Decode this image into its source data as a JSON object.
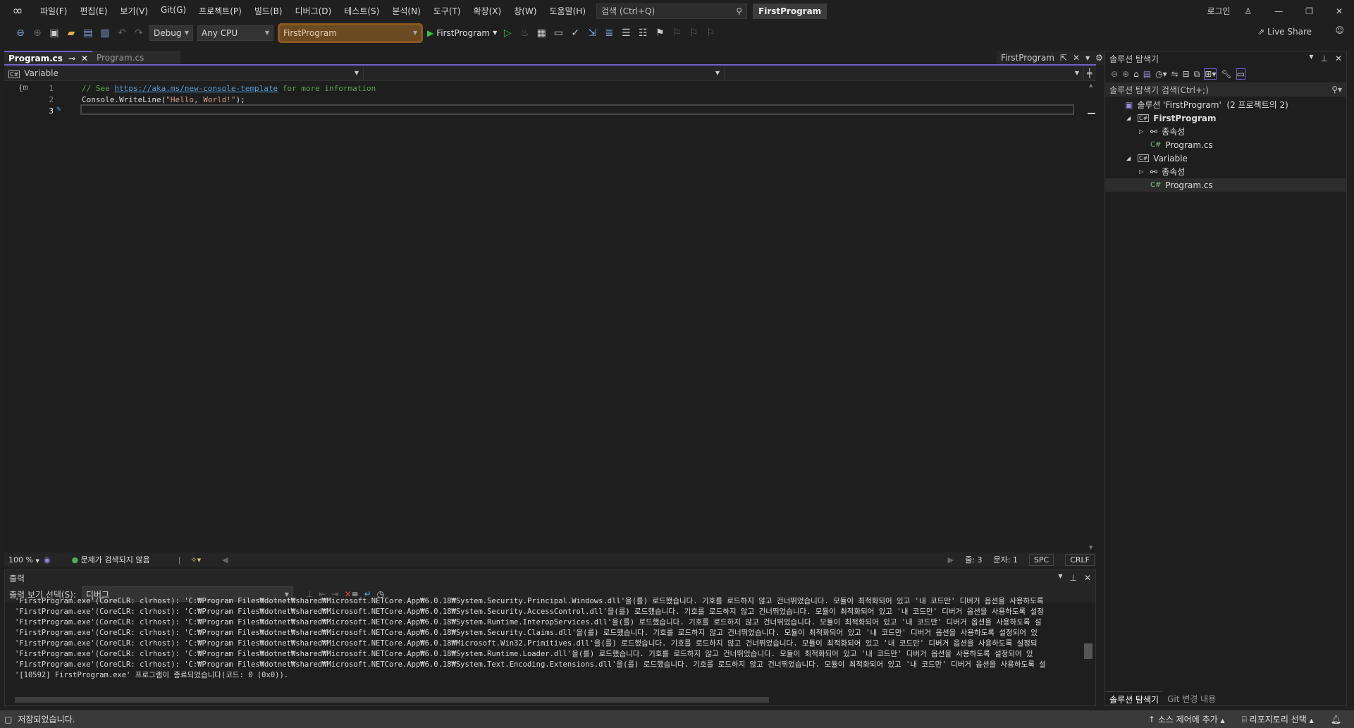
{
  "menubar": {
    "items": [
      "파일(F)",
      "편집(E)",
      "보기(V)",
      "Git(G)",
      "프로젝트(P)",
      "빌드(B)",
      "디버그(D)",
      "테스트(S)",
      "분석(N)",
      "도구(T)",
      "확장(X)",
      "창(W)",
      "도움말(H)"
    ],
    "search_placeholder": "검색 (Ctrl+Q)",
    "project_name": "FirstProgram",
    "login": "로그인"
  },
  "toolbar": {
    "config": "Debug",
    "platform": "Any CPU",
    "startup_project": "FirstProgram",
    "run_label": "FirstProgram",
    "live_share": "Live Share"
  },
  "tabs": [
    {
      "label": "Program.cs",
      "active": true
    },
    {
      "label": "Program.cs",
      "active": false
    }
  ],
  "preview_tab": "FirstProgram",
  "navbar": {
    "project": "Variable"
  },
  "editor": {
    "lines": [
      {
        "num": "1",
        "parts": [
          {
            "t": "// See ",
            "c": "cmt"
          },
          {
            "t": "https://aka.ms/new-console-template",
            "c": "lnk"
          },
          {
            "t": " for more information",
            "c": "cmt"
          }
        ]
      },
      {
        "num": "2",
        "parts": [
          {
            "t": "Console.WriteLine(",
            "c": "id"
          },
          {
            "t": "\"Hello, World!\"",
            "c": "str"
          },
          {
            "t": ");",
            "c": "id"
          }
        ]
      },
      {
        "num": "3",
        "parts": []
      }
    ]
  },
  "editor_status": {
    "zoom": "100 %",
    "issues": "문제가 검색되지 않음",
    "line": "줄: 3",
    "char": "문자: 1",
    "spaces": "SPC",
    "eol": "CRLF"
  },
  "output": {
    "title": "출력",
    "source_label": "출력 보기 선택(S):",
    "source_value": "디버그",
    "lines": [
      "'FirstProgram.exe'(CoreCLR: clrhost): 'C:₩Program Files₩dotnet₩shared₩Microsoft.NETCore.App₩6.0.18₩System.Security.Principal.Windows.dll'을(를) 로드했습니다. 기호를 로드하지 않고 건너뛰었습니다. 모듈이 최적화되어 있고 '내 코드만' 디버거 옵션을 사용하도록",
      "'FirstProgram.exe'(CoreCLR: clrhost): 'C:₩Program Files₩dotnet₩shared₩Microsoft.NETCore.App₩6.0.18₩System.Security.AccessControl.dll'을(를) 로드했습니다. 기호를 로드하지 않고 건너뛰었습니다. 모듈이 최적화되어 있고 '내 코드만' 디버거 옵션을 사용하도록 설정",
      "'FirstProgram.exe'(CoreCLR: clrhost): 'C:₩Program Files₩dotnet₩shared₩Microsoft.NETCore.App₩6.0.18₩System.Runtime.InteropServices.dll'을(를) 로드했습니다. 기호를 로드하지 않고 건너뛰었습니다. 모듈이 최적화되어 있고 '내 코드만' 디버거 옵션을 사용하도록 설",
      "'FirstProgram.exe'(CoreCLR: clrhost): 'C:₩Program Files₩dotnet₩shared₩Microsoft.NETCore.App₩6.0.18₩System.Security.Claims.dll'을(를) 로드했습니다. 기호를 로드하지 않고 건너뛰었습니다. 모듈이 최적화되어 있고 '내 코드만' 디버거 옵션을 사용하도록 설정되어 있",
      "'FirstProgram.exe'(CoreCLR: clrhost): 'C:₩Program Files₩dotnet₩shared₩Microsoft.NETCore.App₩6.0.18₩Microsoft.Win32.Primitives.dll'을(를) 로드했습니다. 기호를 로드하지 않고 건너뛰었습니다. 모듈이 최적화되어 있고 '내 코드만' 디버거 옵션을 사용하도록 설정되",
      "'FirstProgram.exe'(CoreCLR: clrhost): 'C:₩Program Files₩dotnet₩shared₩Microsoft.NETCore.App₩6.0.18₩System.Runtime.Loader.dll'을(를) 로드했습니다. 기호를 로드하지 않고 건너뛰었습니다. 모듈이 최적화되어 있고 '내 코드만' 디버거 옵션을 사용하도록 설정되어 있",
      "'FirstProgram.exe'(CoreCLR: clrhost): 'C:₩Program Files₩dotnet₩shared₩Microsoft.NETCore.App₩6.0.18₩System.Text.Encoding.Extensions.dll'을(를) 로드했습니다. 기호를 로드하지 않고 건너뛰었습니다. 모듈이 최적화되어 있고 '내 코드만' 디버거 옵션을 사용하도록 설",
      "'[10592] FirstProgram.exe' 프로그램이 종료되었습니다(코드: 0 (0x0))."
    ]
  },
  "solution_explorer": {
    "title": "솔루션 탐색기",
    "search_placeholder": "솔루션 탐색기 검색(Ctrl+;)",
    "tree": [
      {
        "label": "솔루션 'FirstProgram'  (2 프로젝트의 2)",
        "level": 0,
        "kind": "solution"
      },
      {
        "label": "FirstProgram",
        "level": 1,
        "kind": "project",
        "expanded": true,
        "bold": true
      },
      {
        "label": "종속성",
        "level": 2,
        "kind": "deps"
      },
      {
        "label": "Program.cs",
        "level": 2,
        "kind": "cs"
      },
      {
        "label": "Variable",
        "level": 1,
        "kind": "project",
        "expanded": true
      },
      {
        "label": "종속성",
        "level": 2,
        "kind": "deps"
      },
      {
        "label": "Program.cs",
        "level": 2,
        "kind": "cs",
        "selected": true
      }
    ],
    "tabs": [
      "솔루션 탐색기",
      "Git 변경 내용"
    ]
  },
  "statusbar": {
    "message": "저장되었습니다.",
    "source_control": "소스 제어에 추가",
    "repository": "리포지토리 선택"
  },
  "colors": {
    "accent": "#7460c9",
    "startup_highlight": "#6b4a22"
  }
}
